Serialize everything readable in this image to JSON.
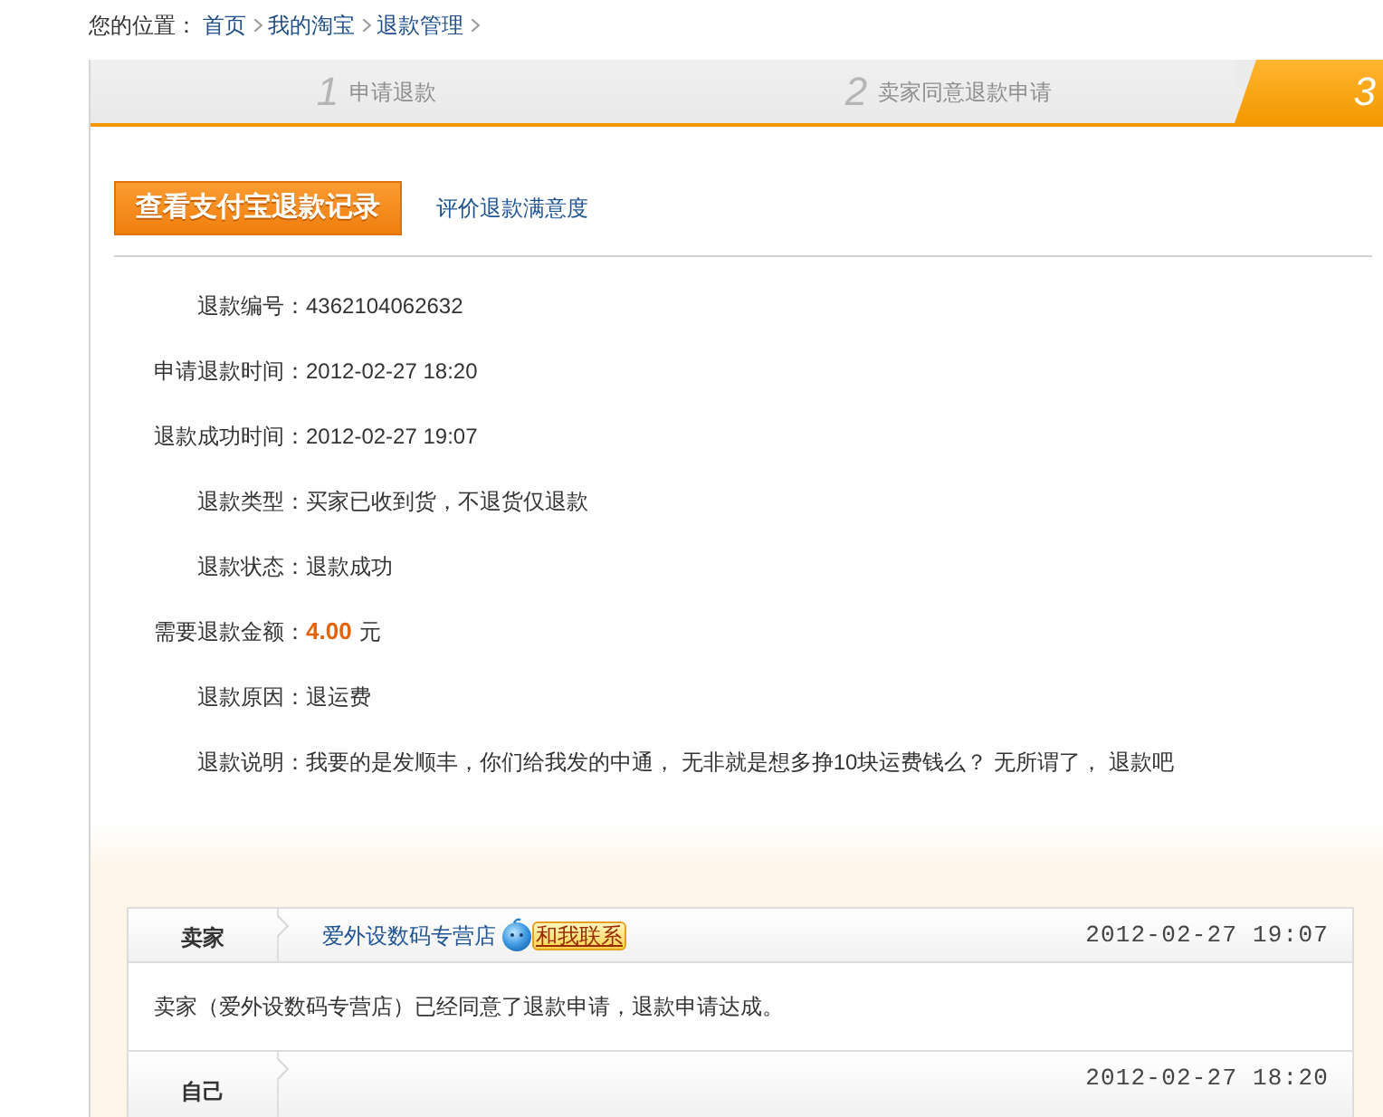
{
  "breadcrumb": {
    "label": "您的位置：",
    "links": [
      "首页",
      "我的淘宝",
      "退款管理"
    ]
  },
  "steps": [
    {
      "number": "1",
      "label": "申请退款",
      "selected": false
    },
    {
      "number": "2",
      "label": "卖家同意退款申请",
      "selected": false
    },
    {
      "number": "3",
      "selected": true
    }
  ],
  "actions": {
    "button": "查看支付宝退款记录",
    "link": "评价退款满意度"
  },
  "details": [
    {
      "kind": "text",
      "label": "退款编号：",
      "value": "4362104062632"
    },
    {
      "kind": "text",
      "label": "申请退款时间：",
      "value": "2012-02-27 18:20"
    },
    {
      "kind": "text",
      "label": "退款成功时间：",
      "value": "2012-02-27 19:07"
    },
    {
      "kind": "text",
      "label": "退款类型：",
      "value": "买家已收到货，不退货仅退款"
    },
    {
      "kind": "text",
      "label": "退款状态：",
      "value": "退款成功"
    },
    {
      "kind": "amount",
      "label": "需要退款金额：",
      "value": "4.00",
      "unit": "元"
    },
    {
      "kind": "text",
      "label": "退款原因：",
      "value": "退运费"
    },
    {
      "kind": "text",
      "label": "退款说明：",
      "value": "我要的是发顺丰，你们给我发的中通， 无非就是想多挣10块运费钱么？ 无所谓了， 退款吧"
    }
  ],
  "messages": [
    {
      "sender": "卖家",
      "shop": "爱外设数码专营店",
      "contact": "和我联系",
      "time": "2012-02-27 19:07",
      "body": "卖家（爱外设数码专营店）已经同意了退款申请，退款申请达成。"
    },
    {
      "sender": "自己",
      "time": "2012-02-27 18:20"
    }
  ]
}
